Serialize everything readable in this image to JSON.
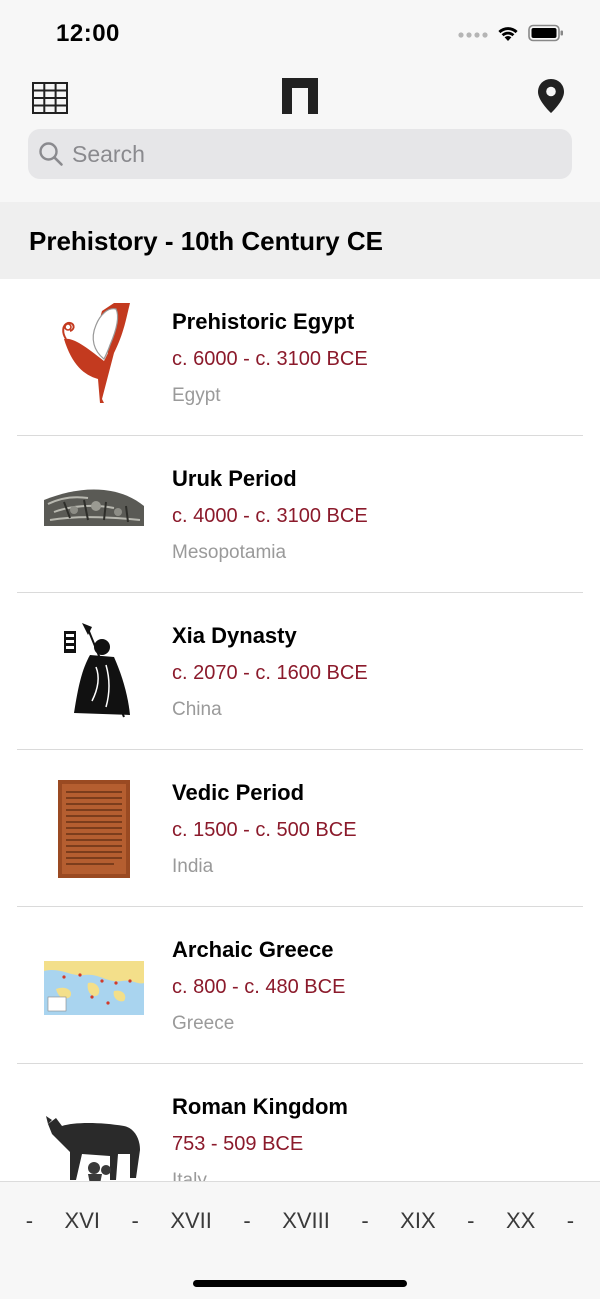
{
  "status_bar": {
    "time": "12:00",
    "icons": [
      "signal-dots-icon",
      "wifi-icon",
      "battery-icon"
    ]
  },
  "nav": {
    "left_icon": "grid-icon",
    "logo_icon": "pi-logo-icon",
    "right_icon": "location-pin-icon",
    "search": {
      "placeholder": "Search",
      "value": ""
    }
  },
  "section": {
    "title": "Prehistory - 10th Century CE"
  },
  "periods": [
    {
      "title": "Prehistoric Egypt",
      "dates": "c. 6000 - c. 3100 BCE",
      "region": "Egypt",
      "thumbnail": "egyptian-vessel"
    },
    {
      "title": "Uruk Period",
      "dates": "c. 4000 - c. 3100 BCE",
      "region": "Mesopotamia",
      "thumbnail": "stone-relief"
    },
    {
      "title": "Xia Dynasty",
      "dates": "c. 2070 - c. 1600 BCE",
      "region": "China",
      "thumbnail": "warrior-figure"
    },
    {
      "title": "Vedic Period",
      "dates": "c. 1500 - c. 500 BCE",
      "region": "India",
      "thumbnail": "manuscript-page"
    },
    {
      "title": "Archaic Greece",
      "dates": "c. 800 - c. 480 BCE",
      "region": "Greece",
      "thumbnail": "mediterranean-map"
    },
    {
      "title": "Roman Kingdom",
      "dates": "753 - 509 BCE",
      "region": "Italy",
      "thumbnail": "she-wolf-statue"
    }
  ],
  "century_nav": {
    "items": [
      "XVI",
      "XVII",
      "XVIII",
      "XIX",
      "XX"
    ],
    "separator": "-"
  },
  "colors": {
    "accent_dates": "#8b1a2b",
    "region_text": "#9a9a9a",
    "bar_bg": "#f7f7f7"
  }
}
